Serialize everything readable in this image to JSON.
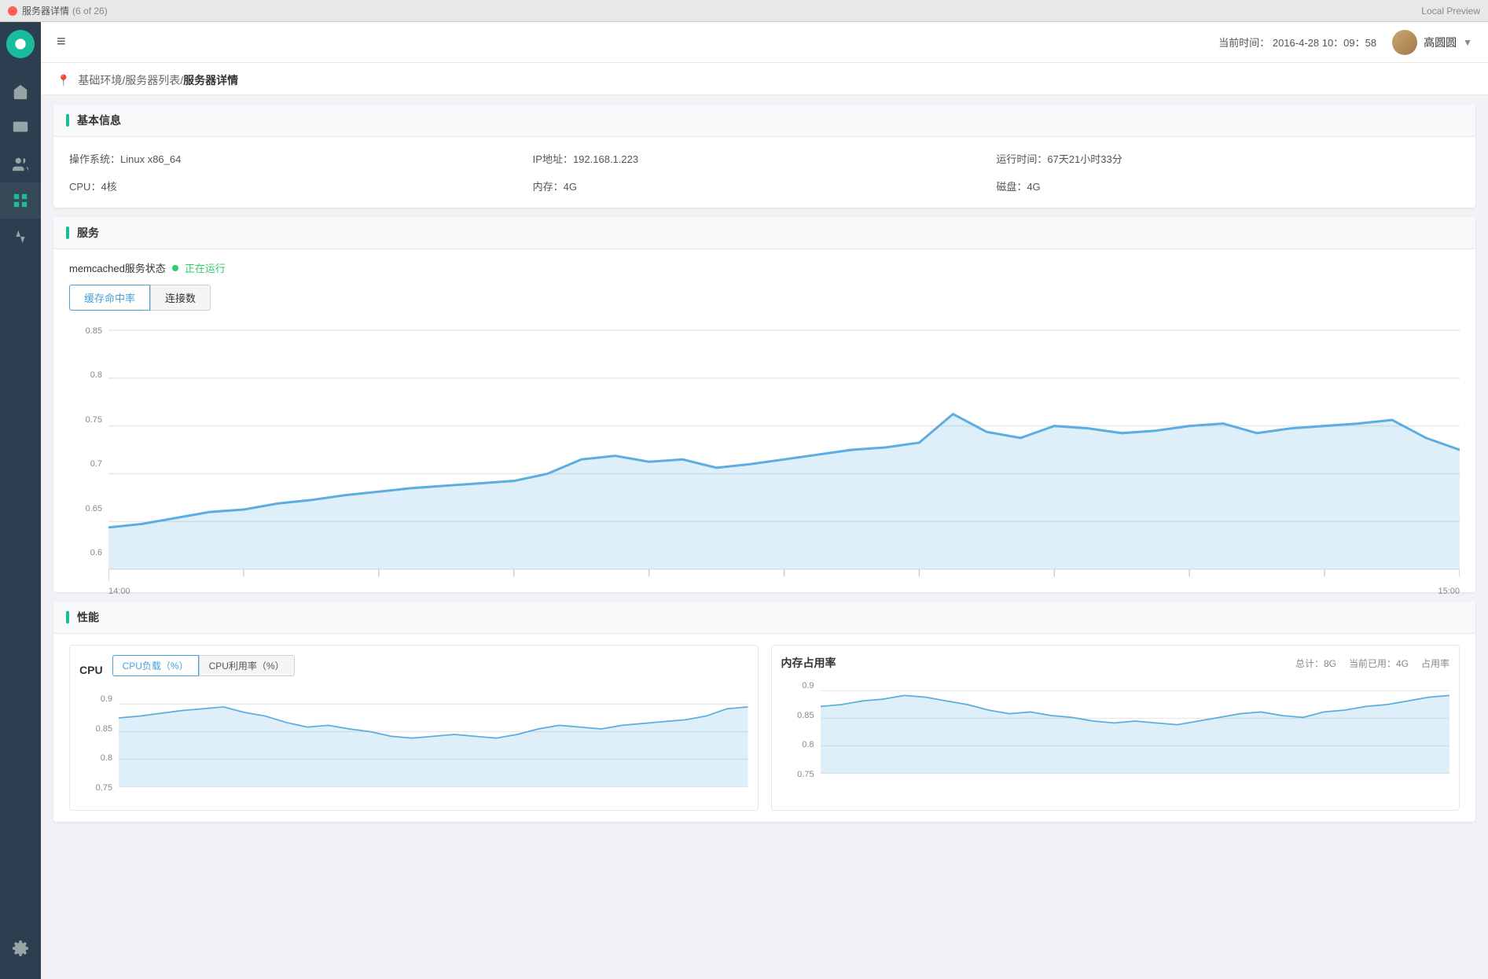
{
  "titleBar": {
    "title": "服务器详情",
    "subtitle": "(6 of 26)",
    "previewLabel": "Local Preview"
  },
  "header": {
    "timeLabel": "当前时间：",
    "time": "2016-4-28  10：09：58",
    "username": "高圆圆",
    "hamburgerIcon": "≡"
  },
  "breadcrumb": {
    "path": "基础环境/服务器列表/",
    "current": "服务器详情"
  },
  "basicInfo": {
    "sectionTitle": "基本信息",
    "os": "操作系统：Linux x86_64",
    "cpu": "CPU：4核",
    "ip": "IP地址：192.168.1.223",
    "memory": "内存：4G",
    "uptime": "运行时间：67天21小时33分",
    "disk": "磁盘：4G"
  },
  "service": {
    "sectionTitle": "服务",
    "serviceLabel": "memcached服务状态",
    "statusText": "正在运行",
    "tabs": [
      "缓存命中率",
      "连接数"
    ],
    "activeTab": 0,
    "chartYLabels": [
      "0.85",
      "0.8",
      "0.75",
      "0.7",
      "0.65",
      "0.6"
    ],
    "chartXLabels": [
      "14:00",
      "15:00"
    ]
  },
  "performance": {
    "sectionTitle": "性能",
    "cpu": {
      "title": "CPU",
      "tabs": [
        "CPU负载（%）",
        "CPU利用率（%）"
      ],
      "activeTab": 0,
      "yLabels": [
        "0.9",
        "0.85",
        "0.8",
        "0.75"
      ]
    },
    "memory": {
      "title": "内存占用率",
      "total": "总计：8G",
      "used": "当前已用：4G",
      "usage": "占用率",
      "yLabels": [
        "0.9",
        "0.85",
        "0.8",
        "0.75"
      ]
    }
  },
  "sidebar": {
    "items": [
      {
        "icon": "home",
        "label": "首页"
      },
      {
        "icon": "monitor",
        "label": "监控"
      },
      {
        "icon": "group",
        "label": "服务"
      },
      {
        "icon": "dashboard",
        "label": "仪表"
      },
      {
        "icon": "chart",
        "label": "性能"
      },
      {
        "icon": "settings",
        "label": "设置"
      }
    ]
  }
}
